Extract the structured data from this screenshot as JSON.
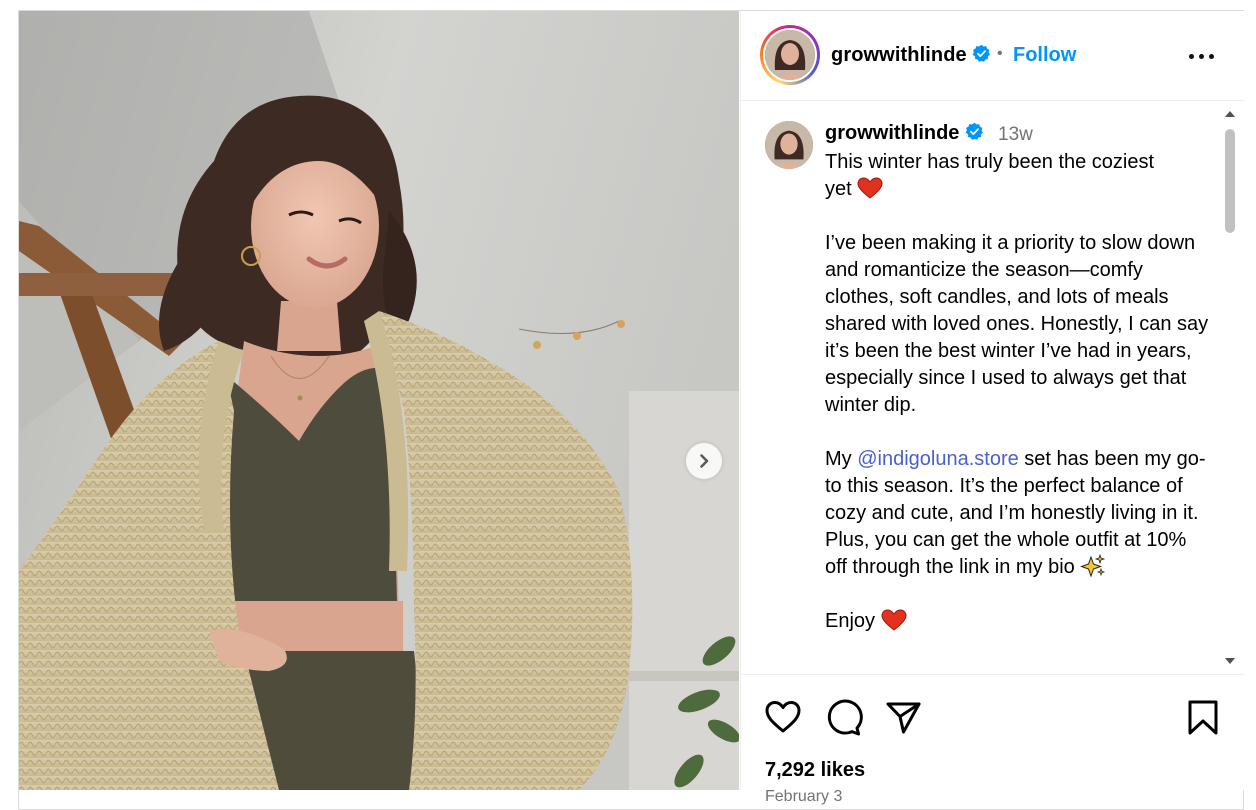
{
  "post": {
    "username": "growwithlinde",
    "verified": true,
    "follow_label": "Follow",
    "separator": "•",
    "time_ago": "13w",
    "caption": {
      "p1_line1": "This winter has truly been the coziest",
      "p1_line2": "yet",
      "p2": "I’ve been making it a priority to slow down and romanticize the season—comfy clothes, soft candles, and lots of meals shared with loved ones. Honestly, I can say it’s been the best winter I’ve had in years, especially since I used to always get that winter dip.",
      "p3_before": "My ",
      "p3_mention": "@indigoluna.store",
      "p3_after": " set has been my go-to this season. It’s the perfect balance of cozy and cute, and I’m honestly living in it. Plus, you can get the whole outfit at 10% off through the link in my bio",
      "p4": "Enjoy"
    },
    "likes": "7,292 likes",
    "date": "February 3"
  },
  "icons": {
    "heart_emoji": "red-heart-icon",
    "sparkles_emoji": "sparkles-icon",
    "like": "heart-outline-icon",
    "comment": "comment-bubble-icon",
    "share": "paper-plane-icon",
    "save": "bookmark-icon",
    "more": "more-horizontal-icon",
    "next": "chevron-right-icon"
  },
  "colors": {
    "follow_blue": "#0095f6",
    "verified_blue": "#0095f6",
    "mention": "#4a5fd0",
    "muted": "#737373",
    "heart_red": "#e0321f"
  }
}
